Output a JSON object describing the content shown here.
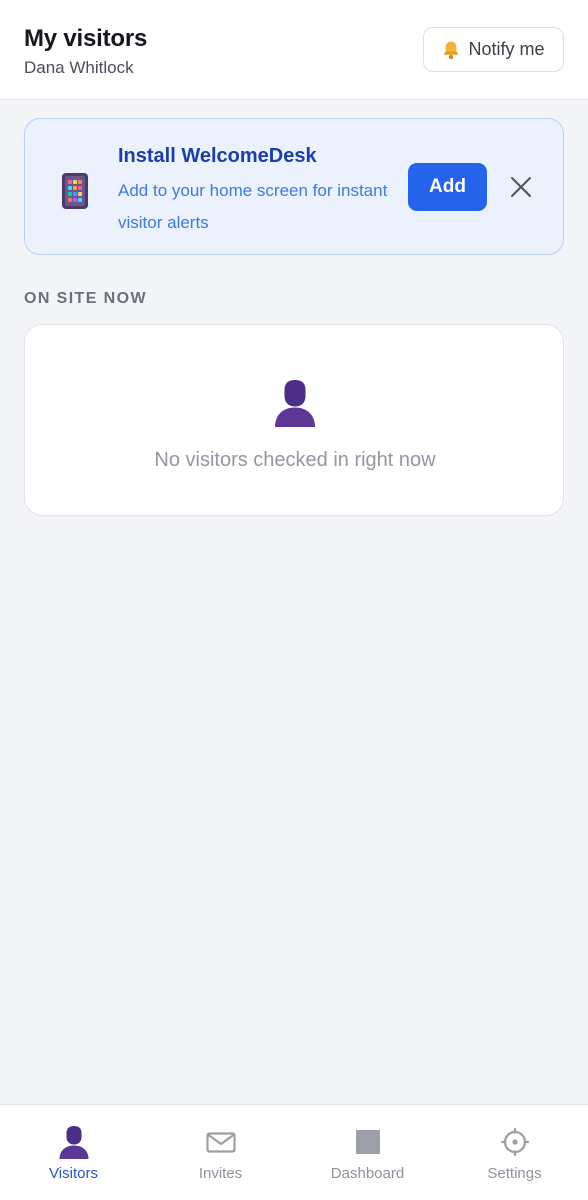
{
  "header": {
    "title": "My visitors",
    "user_name": "Dana Whitlock",
    "notify_label": "Notify me"
  },
  "install_banner": {
    "title": "Install WelcomeDesk",
    "description": "Add to your home screen for instant visitor alerts",
    "add_label": "Add"
  },
  "on_site": {
    "section_label": "ON SITE NOW",
    "empty_message": "No visitors checked in right now"
  },
  "bottom_nav": {
    "items": [
      {
        "label": "Visitors",
        "icon": "person-icon",
        "active": true
      },
      {
        "label": "Invites",
        "icon": "envelope-icon",
        "active": false
      },
      {
        "label": "Dashboard",
        "icon": "square-icon",
        "active": false
      },
      {
        "label": "Settings",
        "icon": "gear-icon",
        "active": false
      }
    ]
  },
  "colors": {
    "accent": "#2563eb",
    "banner_bg": "#ebf1fd",
    "banner_title": "#1d3fa5",
    "banner_text": "#3f7bde",
    "person_icon": "#4c2e86",
    "nav_active": "#2a55c7",
    "nav_inactive": "#8e939d"
  }
}
